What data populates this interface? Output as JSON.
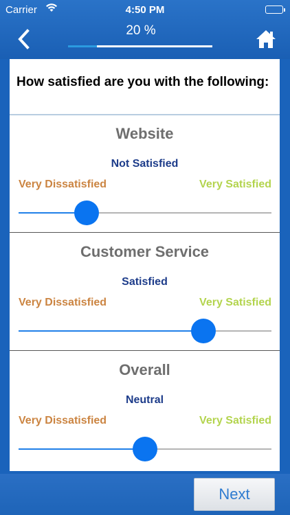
{
  "status_bar": {
    "carrier": "Carrier",
    "time": "4:50 PM"
  },
  "nav": {
    "back_icon": "chevron-left-icon",
    "home_icon": "home-icon",
    "progress_label": "20 %",
    "progress_fraction": 0.2
  },
  "survey": {
    "question": "How satisfied are you with the following:",
    "sections": [
      {
        "title": "Website",
        "value_label": "Not Satisfied",
        "min_label": "Very Dissatisfied",
        "max_label": "Very Satisfied",
        "level": 0.27
      },
      {
        "title": "Customer Service",
        "value_label": "Satisfied",
        "min_label": "Very Dissatisfied",
        "max_label": "Very Satisfied",
        "level": 0.73
      },
      {
        "title": "Overall",
        "value_label": "Neutral",
        "min_label": "Very Dissatisfied",
        "max_label": "Very Satisfied",
        "level": 0.5
      }
    ]
  },
  "footer": {
    "next_label": "Next"
  },
  "colors": {
    "brand_blue": "#1a5fb4",
    "slider_blue": "#0a74f0",
    "min_label_color": "#cb8441",
    "max_label_color": "#b3d44e",
    "value_label_color": "#1d3c8a"
  }
}
